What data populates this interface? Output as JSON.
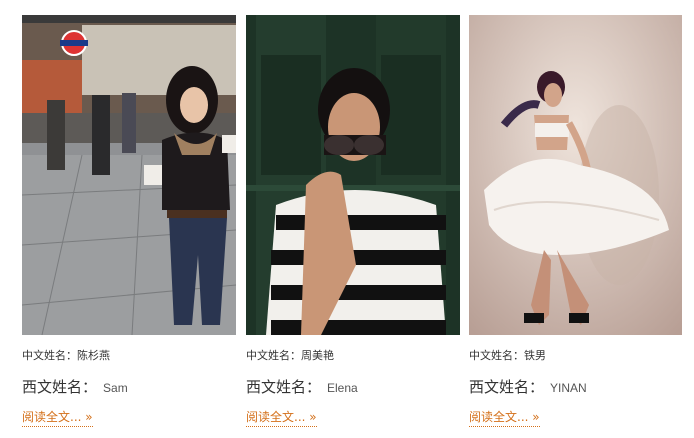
{
  "profiles": [
    {
      "cn_label": "中文姓名：",
      "cn_name": "陈杉燕",
      "en_label": "西文姓名：",
      "en_name": "Sam",
      "read_more": "阅读全文...  »"
    },
    {
      "cn_label": "中文姓名：",
      "cn_name": "周美艳",
      "en_label": "西文姓名：",
      "en_name": "Elena",
      "read_more": "阅读全文...  »"
    },
    {
      "cn_label": "中文姓名：",
      "cn_name": "铁男",
      "en_label": "西文姓名：",
      "en_name": "YINAN",
      "read_more": "阅读全文...  »"
    }
  ],
  "colors": {
    "text": "#333333",
    "link": "#d4701a",
    "photo1_bg": "#8a8c8e",
    "photo2_bg": "#1f3a2a",
    "photo3_bg": "#d8c9bf"
  }
}
